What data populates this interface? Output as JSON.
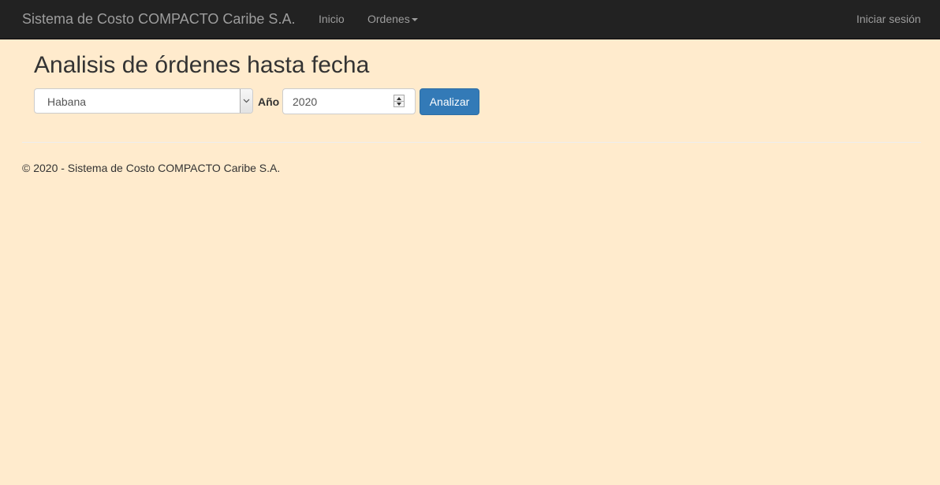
{
  "navbar": {
    "brand": "Sistema de Costo COMPACTO Caribe S.A.",
    "links": [
      {
        "label": "Inicio"
      },
      {
        "label": "Ordenes"
      }
    ],
    "login": "Iniciar sesión"
  },
  "main": {
    "title": "Analisis de órdenes hasta fecha",
    "province_select": {
      "value": "Habana"
    },
    "year_label": "Año",
    "year_input": {
      "value": "2020"
    },
    "analyze_button": "Analizar"
  },
  "footer": {
    "text": "© 2020 - Sistema de Costo COMPACTO Caribe S.A."
  },
  "colors": {
    "background": "#ffebcd",
    "navbar": "#222222",
    "primary": "#337ab7"
  }
}
